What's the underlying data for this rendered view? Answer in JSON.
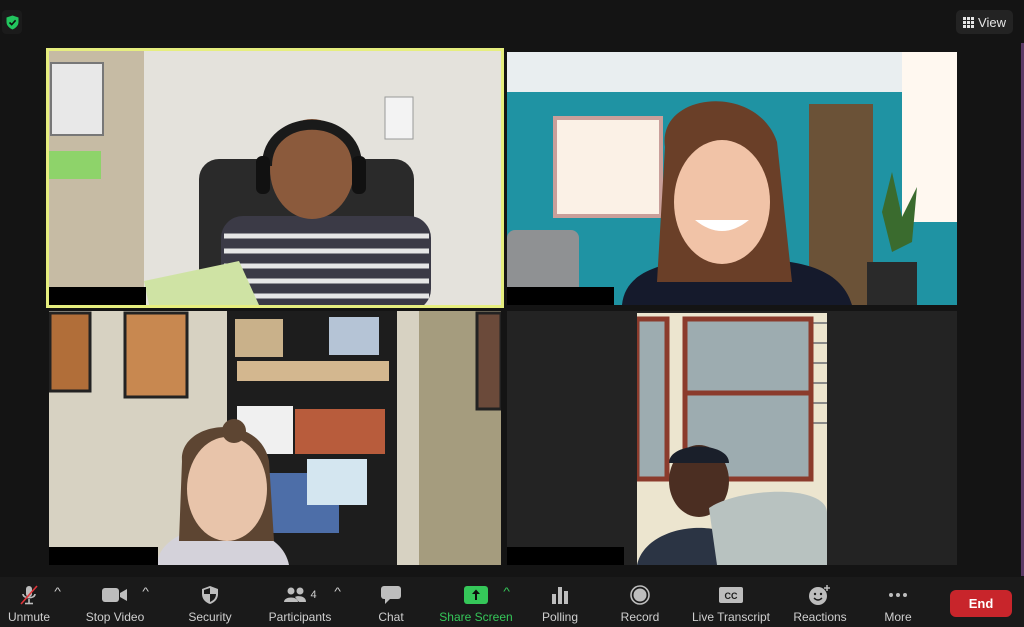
{
  "meeting": {
    "security_badge_icon": "shield-check-icon",
    "view_button": {
      "label": "View",
      "icon": "grid-icon"
    }
  },
  "participants_tiles": [
    {
      "id": "t1",
      "name_label": "",
      "active_speaker": true,
      "video_on": true
    },
    {
      "id": "t2",
      "name_label": "",
      "active_speaker": false,
      "video_on": true
    },
    {
      "id": "t3",
      "name_label": "",
      "active_speaker": false,
      "video_on": true
    },
    {
      "id": "t4",
      "name_label": "",
      "active_speaker": false,
      "video_on": true
    }
  ],
  "toolbar": {
    "unmute": {
      "label": "Unmute",
      "icon": "microphone-muted-icon"
    },
    "stop_video": {
      "label": "Stop Video",
      "icon": "video-camera-icon"
    },
    "security": {
      "label": "Security",
      "icon": "shield-icon"
    },
    "participants": {
      "label": "Participants",
      "icon": "people-icon",
      "count": "4"
    },
    "chat": {
      "label": "Chat",
      "icon": "chat-bubble-icon"
    },
    "share_screen": {
      "label": "Share Screen",
      "icon": "share-arrow-icon"
    },
    "polling": {
      "label": "Polling",
      "icon": "bar-chart-icon"
    },
    "record": {
      "label": "Record",
      "icon": "record-icon"
    },
    "live_transcript": {
      "label": "Live Transcript",
      "icon": "cc-icon",
      "badge": "CC"
    },
    "reactions": {
      "label": "Reactions",
      "icon": "emoji-plus-icon"
    },
    "more": {
      "label": "More",
      "icon": "more-dots-icon"
    },
    "end": {
      "label": "End"
    }
  },
  "colors": {
    "active_speaker_border": "#e6ee7f",
    "share_green": "#35c759",
    "end_red": "#c8252b",
    "security_green": "#22c55e"
  }
}
